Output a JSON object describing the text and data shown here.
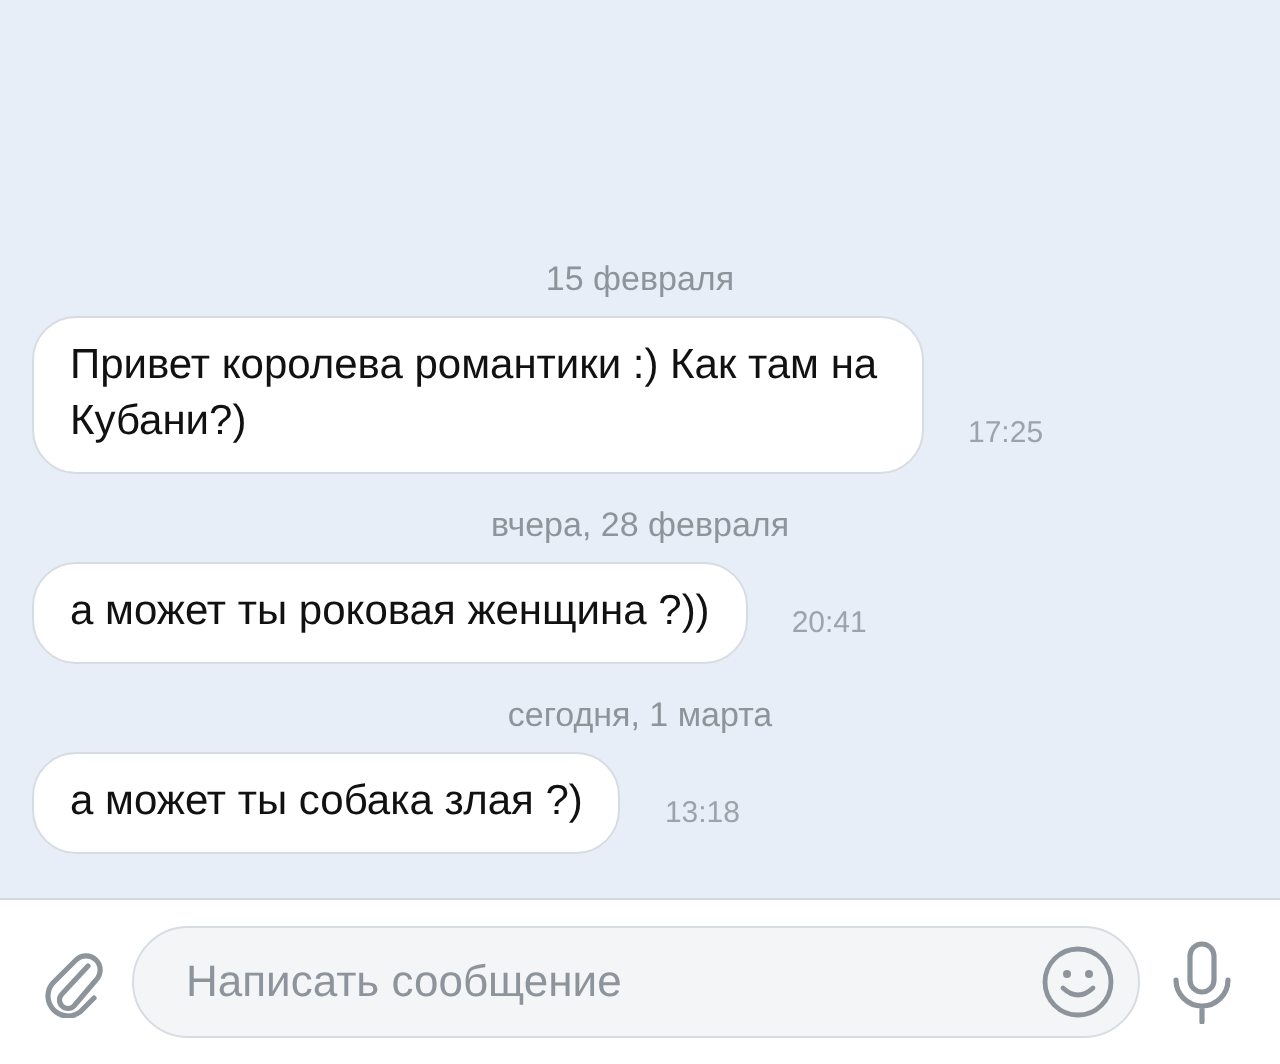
{
  "messages": [
    {
      "kind": "date",
      "text": "15 февраля"
    },
    {
      "kind": "message",
      "text": "Привет королева романтики :) Как там на Кубани?)",
      "time": "17:25"
    },
    {
      "kind": "date",
      "text": "вчера, 28 февраля"
    },
    {
      "kind": "message",
      "text": "а может ты роковая женщина ?))",
      "time": "20:41"
    },
    {
      "kind": "date",
      "text": "сегодня, 1 марта"
    },
    {
      "kind": "message",
      "text": "а может ты собака злая ?)",
      "time": "13:18"
    }
  ],
  "composer": {
    "placeholder": "Написать сообщение"
  }
}
